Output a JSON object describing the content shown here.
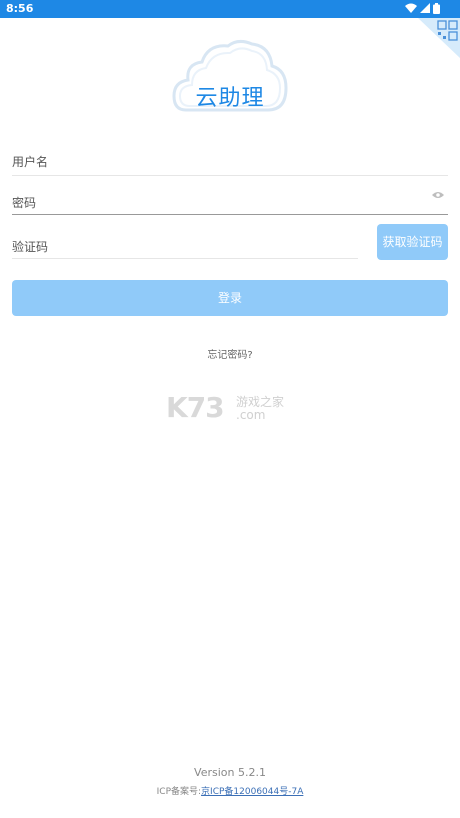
{
  "status_bar": {
    "time": "8:56",
    "icons": [
      "wifi-icon",
      "signal-icon",
      "battery-icon"
    ]
  },
  "logo": {
    "text": "云助理"
  },
  "form": {
    "username_placeholder": "用户名",
    "password_placeholder": "密码",
    "captcha_placeholder": "验证码",
    "get_code_label": "获取验证码",
    "login_label": "登录",
    "forgot_label": "忘记密码?"
  },
  "watermark": {
    "brand": "K73",
    "tagline": "游戏之家",
    "domain": ".com"
  },
  "footer": {
    "version": "Version  5.2.1",
    "icp_prefix": "ICP备案号:",
    "icp_link": "京ICP备12006044号-7A"
  },
  "colors": {
    "primary": "#1e88e5",
    "button_disabled": "#90caf9"
  }
}
